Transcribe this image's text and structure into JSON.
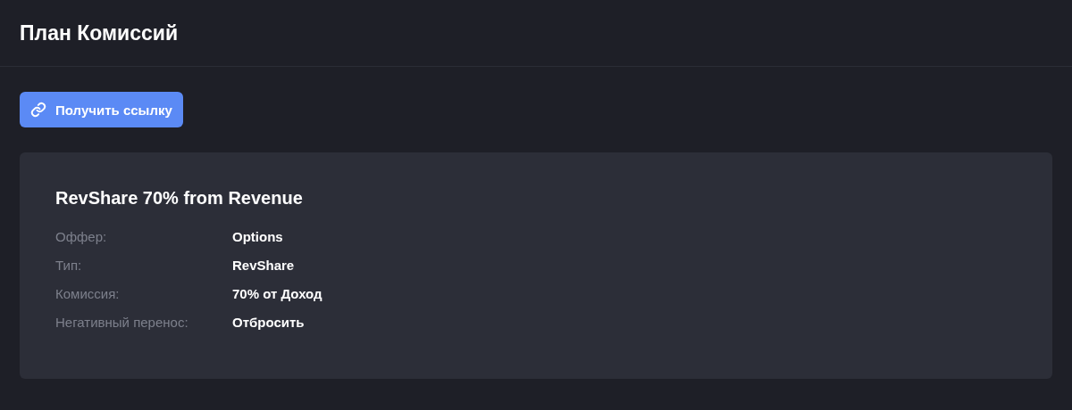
{
  "page": {
    "title": "План Комиссий"
  },
  "link_button": {
    "label": "Получить ссылку"
  },
  "plan": {
    "title": "RevShare 70% from Revenue",
    "fields": [
      {
        "label": "Оффер:",
        "value": "Options"
      },
      {
        "label": "Тип:",
        "value": "RevShare"
      },
      {
        "label": "Комиссия:",
        "value": "70% от Доход"
      },
      {
        "label": "Негативный перенос:",
        "value": "Отбросить"
      }
    ]
  }
}
